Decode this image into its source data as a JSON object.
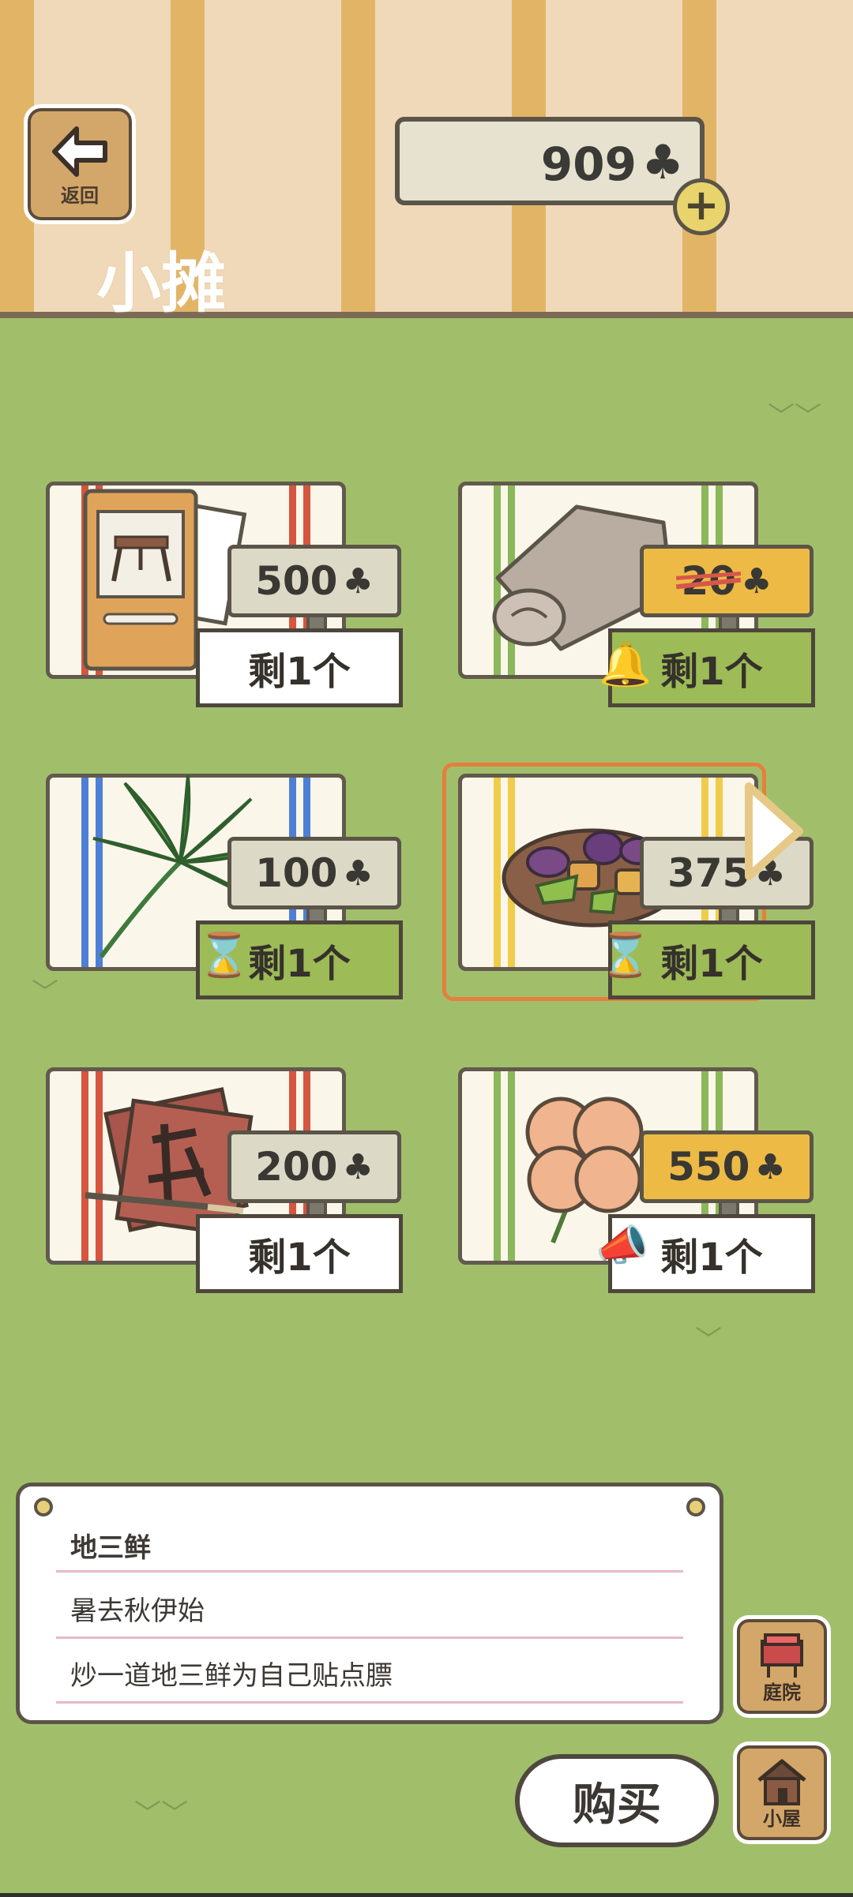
{
  "header": {
    "back_label": "返回",
    "title": "小摊",
    "coins": "909",
    "coin_icon": "clover-icon"
  },
  "items": [
    {
      "price": "500",
      "stock": "剩1个",
      "art": "table-photo-card"
    },
    {
      "price": "20",
      "stock": "剩1个",
      "art": "rolled-cloth",
      "sale": true
    },
    {
      "price": "100",
      "stock": "剩1个",
      "art": "palm-leaf"
    },
    {
      "price": "375",
      "stock": "剩1个",
      "art": "di-san-xian-dish",
      "selected": true
    },
    {
      "price": "200",
      "stock": "剩1个",
      "art": "calligraphy-paper"
    },
    {
      "price": "550",
      "stock": "剩1个",
      "art": "four-leaf-clover"
    }
  ],
  "description": {
    "name": "地三鲜",
    "line1": "暑去秋伊始",
    "line2": "炒一道地三鲜为自己贴点膘"
  },
  "side_buttons": {
    "yard": "庭院",
    "house": "小屋"
  },
  "buy_label": "购买",
  "colors": {
    "grass": "#a1bf6b",
    "stripe_dark": "#e2b466",
    "stripe_light": "#f0d9b9",
    "selected": "#e57f3d"
  }
}
